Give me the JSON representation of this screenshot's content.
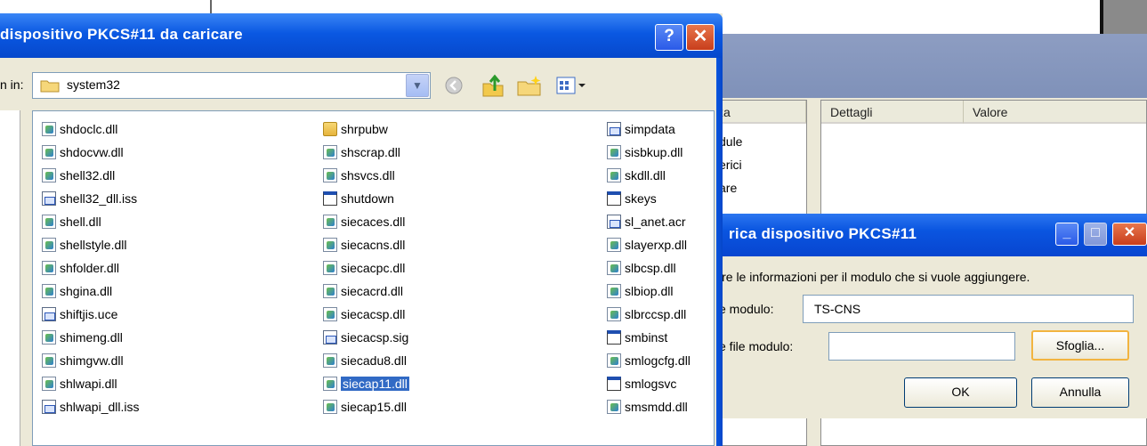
{
  "colors": {
    "xp_blue": "#0a55e0",
    "xp_face": "#ece9d8",
    "selection": "#316ac5",
    "close_red": "#c83e1c"
  },
  "open_dialog": {
    "title": "dispositivo PKCS#11 da caricare",
    "help_glyph": "?",
    "close_glyph": "✕",
    "look_in_label": "n in:",
    "look_in_value": "system32",
    "toolbar_icons": [
      "back-icon",
      "up-folder-icon",
      "new-folder-icon",
      "views-menu-icon"
    ],
    "files": {
      "col1": [
        {
          "name": "shdoclc.dll",
          "icon": "dll"
        },
        {
          "name": "shdocvw.dll",
          "icon": "dll"
        },
        {
          "name": "shell32.dll",
          "icon": "dll"
        },
        {
          "name": "shell32_dll.iss",
          "icon": "doc"
        },
        {
          "name": "shell.dll",
          "icon": "dll"
        },
        {
          "name": "shellstyle.dll",
          "icon": "dll"
        },
        {
          "name": "shfolder.dll",
          "icon": "dll"
        },
        {
          "name": "shgina.dll",
          "icon": "dll"
        },
        {
          "name": "shiftjis.uce",
          "icon": "doc"
        },
        {
          "name": "shimeng.dll",
          "icon": "dll"
        },
        {
          "name": "shimgvw.dll",
          "icon": "dll"
        },
        {
          "name": "shlwapi.dll",
          "icon": "dll"
        },
        {
          "name": "shlwapi_dll.iss",
          "icon": "doc"
        }
      ],
      "col2": [
        {
          "name": "shrpubw",
          "icon": "fold"
        },
        {
          "name": "shscrap.dll",
          "icon": "dll"
        },
        {
          "name": "shsvcs.dll",
          "icon": "dll"
        },
        {
          "name": "shutdown",
          "icon": "exe"
        },
        {
          "name": "siecaces.dll",
          "icon": "dll"
        },
        {
          "name": "siecacns.dll",
          "icon": "dll"
        },
        {
          "name": "siecacpc.dll",
          "icon": "dll"
        },
        {
          "name": "siecacrd.dll",
          "icon": "dll"
        },
        {
          "name": "siecacsp.dll",
          "icon": "dll"
        },
        {
          "name": "siecacsp.sig",
          "icon": "doc"
        },
        {
          "name": "siecadu8.dll",
          "icon": "dll"
        },
        {
          "name": "siecap11.dll",
          "icon": "dll",
          "selected": true
        },
        {
          "name": "siecap15.dll",
          "icon": "dll"
        }
      ],
      "col3": [
        {
          "name": "simpdata",
          "icon": "doc"
        },
        {
          "name": "sisbkup.dll",
          "icon": "dll"
        },
        {
          "name": "skdll.dll",
          "icon": "dll"
        },
        {
          "name": "skeys",
          "icon": "exe"
        },
        {
          "name": "sl_anet.acr",
          "icon": "doc"
        },
        {
          "name": "slayerxp.dll",
          "icon": "dll"
        },
        {
          "name": "slbcsp.dll",
          "icon": "dll"
        },
        {
          "name": "slbiop.dll",
          "icon": "dll"
        },
        {
          "name": "slbrccsp.dll",
          "icon": "dll"
        },
        {
          "name": "smbinst",
          "icon": "exe"
        },
        {
          "name": "smlogcfg.dll",
          "icon": "dll"
        },
        {
          "name": "smlogsvc",
          "icon": "exe"
        },
        {
          "name": "smsmdd.dll",
          "icon": "dll"
        }
      ]
    }
  },
  "background_window": {
    "left_header": "za",
    "left_items": [
      "dule",
      "erici",
      "are"
    ],
    "right_headers": [
      "Dettagli",
      "Valore"
    ]
  },
  "load_dialog": {
    "title": "rica dispositivo PKCS#11",
    "min_glyph": "_",
    "max_glyph": "□",
    "close_glyph": "✕",
    "instruction": "ire le informazioni per il modulo che si vuole aggiungere.",
    "module_name_label": "e modulo:",
    "module_name_value": "TS-CNS",
    "module_file_label": "e file modulo:",
    "module_file_value": "",
    "browse_label": "Sfoglia...",
    "ok_label": "OK",
    "cancel_label": "Annulla"
  }
}
